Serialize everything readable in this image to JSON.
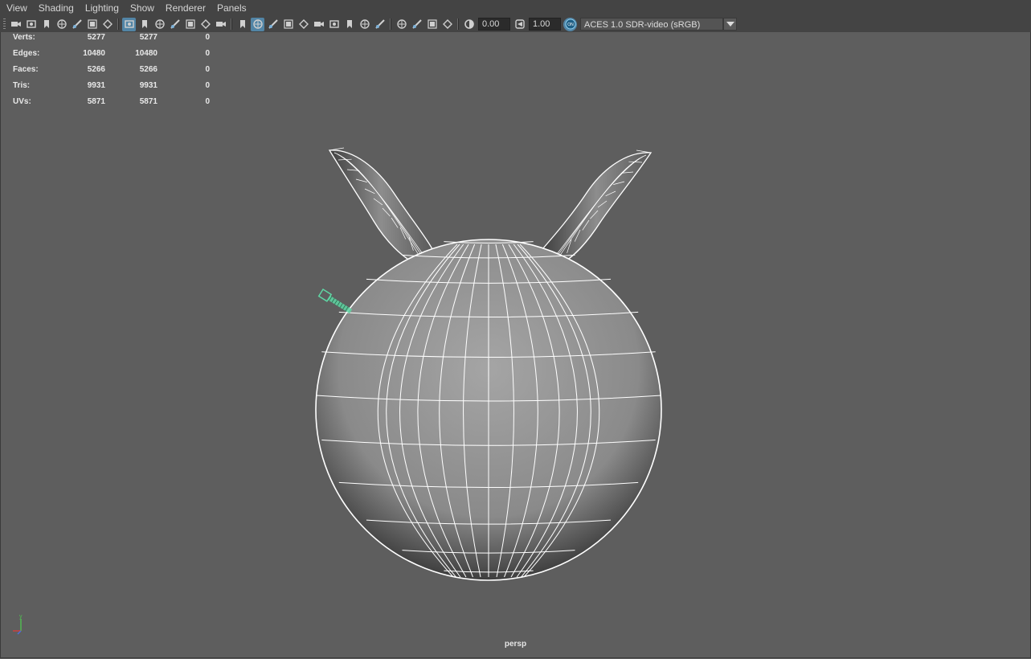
{
  "menu": [
    "View",
    "Shading",
    "Lighting",
    "Show",
    "Renderer",
    "Panels"
  ],
  "toolbar": {
    "icons_group1": [
      "select-camera-icon",
      "camera-attributes-icon",
      "bookmarks-icon",
      "bookmark-icon",
      "image-plane-icon",
      "2d-pan-zoom-icon",
      "grease-pencil-icon"
    ],
    "icons_group2": [
      "grid-icon",
      "film-gate-icon",
      "resolution-gate-icon",
      "gate-mask-icon",
      "field-chart-icon",
      "safe-action-icon",
      "safe-title-icon"
    ],
    "icons_group3": [
      "wireframe-icon",
      "smooth-shade-icon",
      "default-material-icon",
      "textured-icon",
      "use-all-lights-icon",
      "shadows-icon",
      "screen-space-ao-icon",
      "motion-blur-icon",
      "multisample-aa-icon",
      "depth-of-field-icon"
    ],
    "icons_group4": [
      "isolate-select-icon",
      "xray-icon",
      "xray-active-components-icon",
      "xray-joints-icon"
    ],
    "exposure_value": "0.00",
    "gamma_value": "1.00",
    "color_management_badge": "ON",
    "color_space": "ACES 1.0 SDR-video (sRGB)"
  },
  "hud": [
    {
      "label": "Verts:",
      "v1": "5277",
      "v2": "5277",
      "v3": "0"
    },
    {
      "label": "Edges:",
      "v1": "10480",
      "v2": "10480",
      "v3": "0"
    },
    {
      "label": "Faces:",
      "v1": "5266",
      "v2": "5266",
      "v3": "0"
    },
    {
      "label": "Tris:",
      "v1": "9931",
      "v2": "9931",
      "v3": "0"
    },
    {
      "label": "UVs:",
      "v1": "5871",
      "v2": "5871",
      "v3": "0"
    }
  ],
  "camera_label": "persp",
  "colors": {
    "background": "#5e5e5e",
    "toolbar": "#444444",
    "active_icon": "#5285a6",
    "wireframe": "#ffffff",
    "locator": "#5fd6a4",
    "axis_x": "#d04040",
    "axis_y": "#50c050",
    "axis_z": "#4a70e0"
  }
}
